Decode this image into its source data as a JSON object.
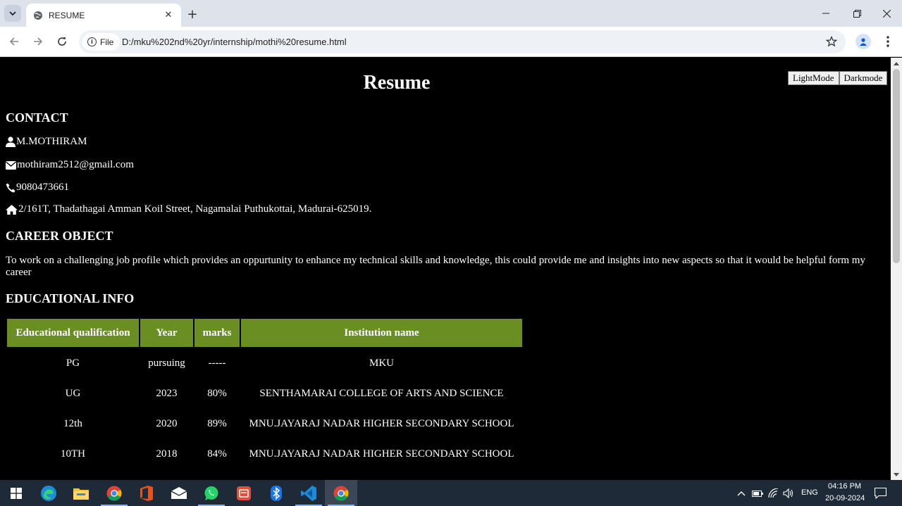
{
  "browser": {
    "tab_title": "RESUME",
    "site_chip_label": "File",
    "url": "D:/mku%202nd%20yr/internship/mothi%20resume.html"
  },
  "page": {
    "title": "Resume",
    "buttons": {
      "light": "LightMode",
      "dark": "Darkmode"
    },
    "contact": {
      "heading": "CONTACT",
      "name": "M.MOTHIRAM",
      "email": "mothiram2512@gmail.com",
      "phone": "9080473661",
      "address": "2/161T, Thadathagai Amman Koil Street, Nagamalai Puthukottai, Madurai-625019."
    },
    "career": {
      "heading": "CAREER OBJECT",
      "text": "To work on a challenging job profile which provides an oppurtunity to enhance my technical skills and knowledge, this could provide me and insights into new aspects so that it would be helpful form my career"
    },
    "education": {
      "heading": "EDUCATIONAL INFO",
      "columns": [
        "Educational qualification",
        "Year",
        "marks",
        "Institution name"
      ],
      "rows": [
        [
          "PG",
          "pursuing",
          "-----",
          "MKU"
        ],
        [
          "UG",
          "2023",
          "80%",
          "SENTHAMARAI COLLEGE OF ARTS AND SCIENCE"
        ],
        [
          "12th",
          "2020",
          "89%",
          "MNU.JAYARAJ NADAR HIGHER SECONDARY SCHOOL"
        ],
        [
          "10TH",
          "2018",
          "84%",
          "MNU.JAYARAJ NADAR HIGHER SECONDARY SCHOOL"
        ]
      ],
      "header_color": "#6b8e23"
    }
  },
  "taskbar": {
    "apps": [
      "start-icon",
      "edge-icon",
      "file-explorer-icon",
      "chrome-icon",
      "office-icon",
      "mail-icon",
      "whatsapp-icon",
      "wps-icon",
      "bluetooth-icon",
      "vscode-icon",
      "chrome-icon"
    ],
    "language": "ENG",
    "time": "04:16 PM",
    "date": "20-09-2024"
  }
}
